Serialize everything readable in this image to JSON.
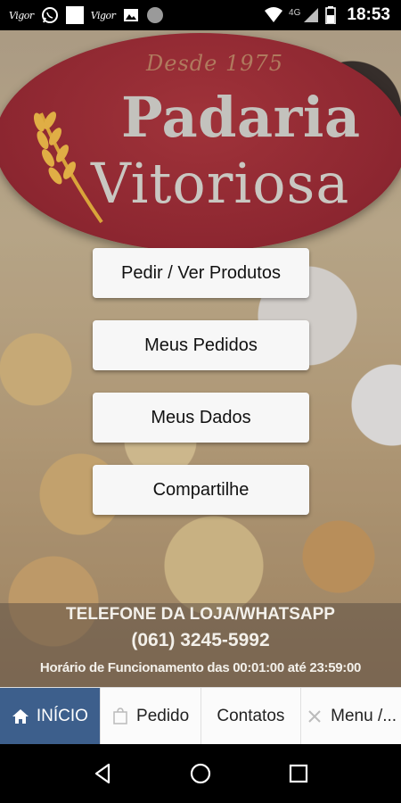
{
  "status_bar": {
    "notification_badges": [
      "Vigor",
      "Vigor"
    ],
    "network_label": "4G",
    "time": "18:53"
  },
  "logo": {
    "since": "Desde 1975",
    "line1": "Padaria",
    "line2": "Vitoriosa",
    "brand_color": "#8c2630"
  },
  "menu": {
    "buttons": [
      {
        "label": "Pedir / Ver Produtos"
      },
      {
        "label": "Meus Pedidos"
      },
      {
        "label": "Meus Dados"
      },
      {
        "label": "Compartilhe"
      }
    ]
  },
  "info": {
    "title": "TELEFONE DA LOJA/WHATSAPP",
    "phone": "(061) 3245-5992",
    "hours": "Horário de Funcionamento das 00:01:00 até 23:59:00"
  },
  "tabs": [
    {
      "label": "INÍCIO",
      "icon": "home-icon",
      "active": true
    },
    {
      "label": "Pedido",
      "icon": "bag-icon",
      "active": false
    },
    {
      "label": "Contatos",
      "icon": "",
      "active": false
    },
    {
      "label": "Menu /...",
      "icon": "close-icon",
      "active": false
    }
  ],
  "colors": {
    "active_tab": "#3d5f8c",
    "logo_oval": "#8c2630"
  }
}
